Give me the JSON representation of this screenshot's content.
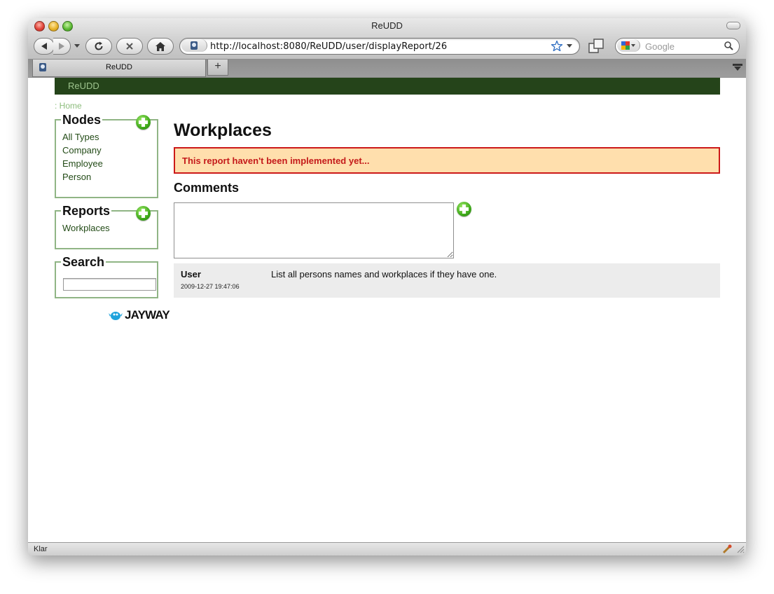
{
  "browser": {
    "window_title": "ReUDD",
    "url": "http://localhost:8080/ReUDD/user/displayReport/26",
    "search_placeholder": "Google",
    "tab_title": "ReUDD",
    "new_tab_label": "+",
    "status": "Klar"
  },
  "site": {
    "title": "ReUDD",
    "breadcrumb": ": Home",
    "logo": "JAYWAY"
  },
  "sidebar": {
    "nodes": {
      "title": "Nodes",
      "items": [
        "All Types",
        "Company",
        "Employee",
        "Person"
      ]
    },
    "reports": {
      "title": "Reports",
      "items": [
        "Workplaces"
      ]
    },
    "search": {
      "title": "Search",
      "value": ""
    }
  },
  "main": {
    "title": "Workplaces",
    "warning": "This report haven't been implemented yet...",
    "comments_title": "Comments",
    "comments": [
      {
        "user": "User",
        "date": "2009-12-27 19:47:06",
        "text": "List all persons names and workplaces if they have one."
      }
    ]
  },
  "colors": {
    "header_bg": "#25441a",
    "header_text": "#9ec48e",
    "box_border": "#90b585",
    "warning_bg": "#ffdfad",
    "warning_border": "#cc1919",
    "comment_bg": "#ececec"
  }
}
